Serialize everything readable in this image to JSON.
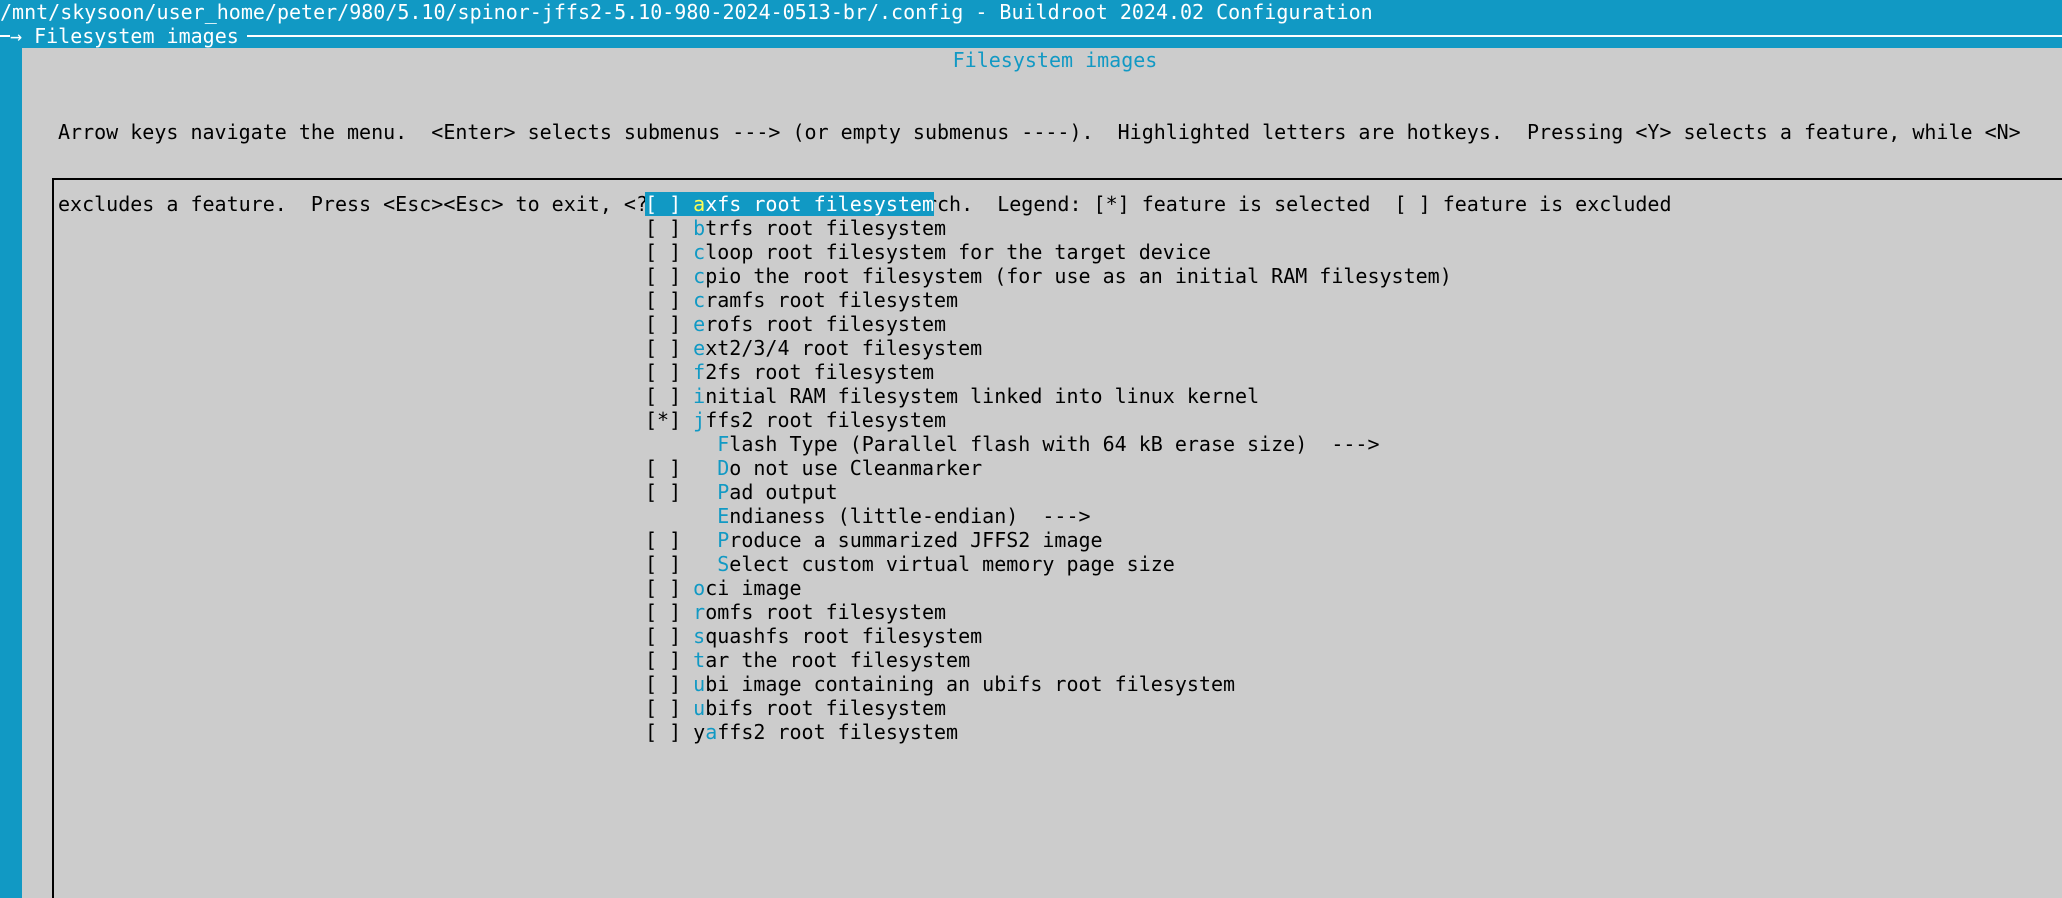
{
  "window": {
    "title": "/mnt/skysoon/user_home/peter/980/5.10/spinor-jffs2-5.10-980-2024-0513-br/.config - Buildroot 2024.02 Configuration",
    "breadcrumb": "→ Filesystem images"
  },
  "dialog": {
    "title": "Filesystem images",
    "help_line1": "Arrow keys navigate the menu.  <Enter> selects submenus ---> (or empty submenus ----).  Highlighted letters are hotkeys.  Pressing <Y> selects a feature, while <N>",
    "help_line2": "excludes a feature.  Press <Esc><Esc> to exit, <?> for Help, </> for Search.  Legend: [*] feature is selected  [ ] feature is excluded"
  },
  "colors": {
    "background": "#1199c4",
    "dialog": "#cccccc",
    "hotkey": "#1199c4",
    "selected_hotkey": "#ffff55"
  },
  "menu": {
    "items": [
      {
        "prefix": "[ ] ",
        "hot": "a",
        "rest": "xfs root filesystem",
        "selected": true
      },
      {
        "prefix": "[ ] ",
        "hot": "b",
        "rest": "trfs root filesystem"
      },
      {
        "prefix": "[ ] ",
        "hot": "c",
        "rest": "loop root filesystem for the target device"
      },
      {
        "prefix": "[ ] ",
        "hot": "c",
        "rest": "pio the root filesystem (for use as an initial RAM filesystem)"
      },
      {
        "prefix": "[ ] ",
        "hot": "c",
        "rest": "ramfs root filesystem"
      },
      {
        "prefix": "[ ] ",
        "hot": "e",
        "rest": "rofs root filesystem"
      },
      {
        "prefix": "[ ] ",
        "hot": "e",
        "rest": "xt2/3/4 root filesystem"
      },
      {
        "prefix": "[ ] ",
        "hot": "f",
        "rest": "2fs root filesystem"
      },
      {
        "prefix": "[ ] ",
        "hot": "i",
        "rest": "nitial RAM filesystem linked into linux kernel"
      },
      {
        "prefix": "[*] ",
        "hot": "j",
        "rest": "ffs2 root filesystem"
      },
      {
        "prefix": "      ",
        "hot": "F",
        "rest": "lash Type (Parallel flash with 64 kB erase size)  --->"
      },
      {
        "prefix": "[ ]   ",
        "hot": "D",
        "rest": "o not use Cleanmarker"
      },
      {
        "prefix": "[ ]   ",
        "hot": "P",
        "rest": "ad output"
      },
      {
        "prefix": "      ",
        "hot": "E",
        "rest": "ndianess (little-endian)  --->"
      },
      {
        "prefix": "[ ]   ",
        "hot": "P",
        "rest": "roduce a summarized JFFS2 image"
      },
      {
        "prefix": "[ ]   ",
        "hot": "S",
        "rest": "elect custom virtual memory page size"
      },
      {
        "prefix": "[ ] ",
        "hot": "o",
        "rest": "ci image"
      },
      {
        "prefix": "[ ] ",
        "hot": "r",
        "rest": "omfs root filesystem"
      },
      {
        "prefix": "[ ] ",
        "hot": "s",
        "rest": "quashfs root filesystem"
      },
      {
        "prefix": "[ ] ",
        "hot": "t",
        "rest": "ar the root filesystem"
      },
      {
        "prefix": "[ ] ",
        "hot": "u",
        "rest": "bi image containing an ubifs root filesystem"
      },
      {
        "prefix": "[ ] ",
        "hot": "u",
        "rest": "bifs root filesystem"
      },
      {
        "prefix": "[ ] y",
        "hot": "a",
        "rest": "ffs2 root filesystem"
      }
    ]
  }
}
